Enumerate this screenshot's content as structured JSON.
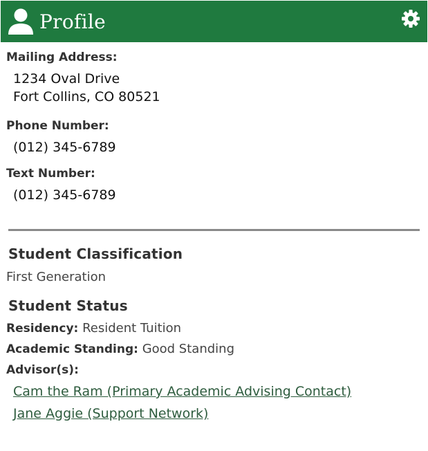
{
  "colors": {
    "brand": "#1f7a3f",
    "link": "#2e5c3e",
    "divider": "#8a8a8a"
  },
  "header": {
    "title": "Profile",
    "icon": "person-icon",
    "settings_icon": "gear-icon"
  },
  "contact": {
    "mailing_label": "Mailing Address:",
    "mailing_line1": "1234 Oval Drive",
    "mailing_line2": "Fort Collins, CO 80521",
    "phone_label": "Phone Number:",
    "phone_value": "(012) 345-6789",
    "text_label": "Text Number:",
    "text_value": "(012) 345-6789"
  },
  "classification": {
    "title": "Student Classification",
    "value": "First Generation"
  },
  "status": {
    "title": "Student Status",
    "residency_label": "Residency:",
    "residency_value": "Resident Tuition",
    "standing_label": "Academic Standing:",
    "standing_value": "Good Standing",
    "advisors_label": "Advisor(s):",
    "advisors": [
      {
        "name": "Cam the Ram (Primary Academic Advising Contact)"
      },
      {
        "name": "Jane Aggie (Support Network)"
      }
    ]
  }
}
